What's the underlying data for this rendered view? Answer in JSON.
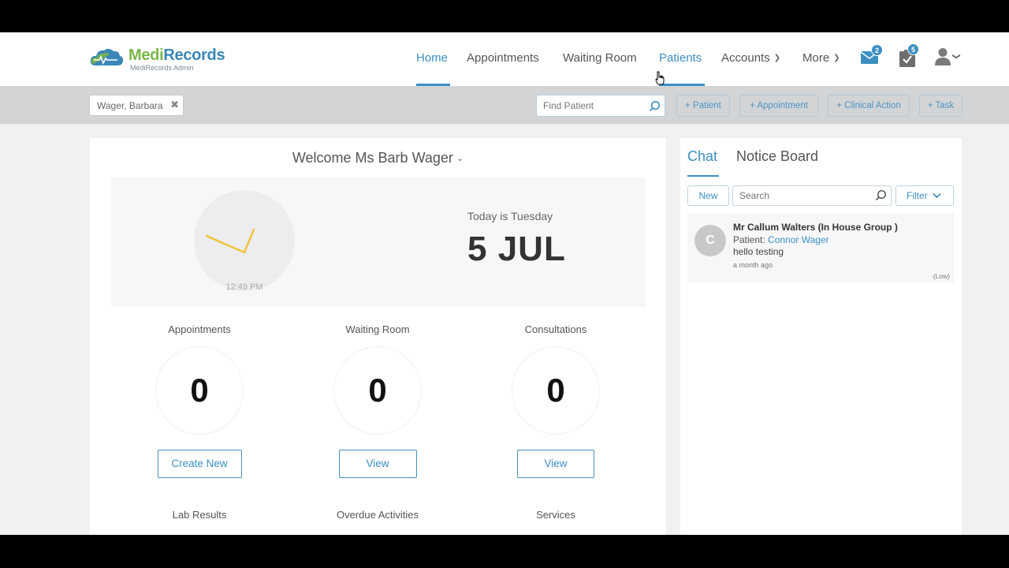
{
  "app": {
    "logo_name_part1": "Medi",
    "logo_name_part2": "Records",
    "logo_subtitle": "MediRecords Admin"
  },
  "nav": {
    "home": "Home",
    "appointments": "Appointments",
    "waiting_room": "Waiting Room",
    "patients": "Patients",
    "accounts": "Accounts",
    "more": "More",
    "mail_badge": "2",
    "tasks_badge": "5"
  },
  "toolbar": {
    "open_patient": "Wager, Barbara",
    "find_placeholder": "Find Patient",
    "add_patient": "+ Patient",
    "add_appointment": "+ Appointment",
    "add_clinical_action": "+ Clinical Action",
    "add_task": "+ Task"
  },
  "dashboard": {
    "welcome": "Welcome Ms Barb Wager",
    "clock_time": "12:49 PM",
    "today_label": "Today is Tuesday",
    "date": "5 JUL",
    "stats": [
      {
        "label": "Appointments",
        "value": "0",
        "button": "Create New"
      },
      {
        "label": "Waiting Room",
        "value": "0",
        "button": "View"
      },
      {
        "label": "Consultations",
        "value": "0",
        "button": "View"
      }
    ],
    "stats_row2": [
      "Lab Results",
      "Overdue Activities",
      "Services"
    ]
  },
  "sidepanel": {
    "tabs": [
      "Chat",
      "Notice Board"
    ],
    "new_button": "New",
    "search_placeholder": "Search",
    "filter_button": "Filter",
    "messages": [
      {
        "avatar_initial": "C",
        "from": "Mr Callum Walters (In House Group )",
        "patient_label": "Patient: ",
        "patient_name": "Connor Wager",
        "text": "hello testing",
        "time": "a month ago",
        "priority": "(Low)"
      }
    ]
  },
  "colors": {
    "accent": "#3d8fc2",
    "logo_green": "#7ab648",
    "subbar": "#d2d4d6",
    "clock_hand": "#f2c335"
  }
}
